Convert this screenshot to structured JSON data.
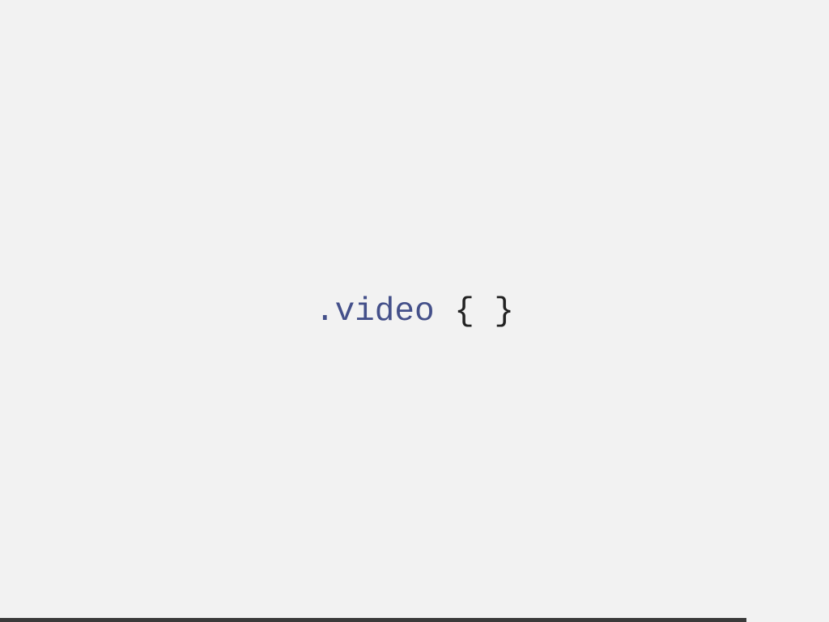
{
  "slide": {
    "code": {
      "selector": ".video",
      "open_brace": "{",
      "close_brace": "}"
    },
    "colors": {
      "background": "#f2f2f2",
      "selector": "#44508a",
      "brace": "#222222",
      "progress": "#3a3a3a"
    },
    "progress": {
      "fraction": 0.9
    }
  }
}
